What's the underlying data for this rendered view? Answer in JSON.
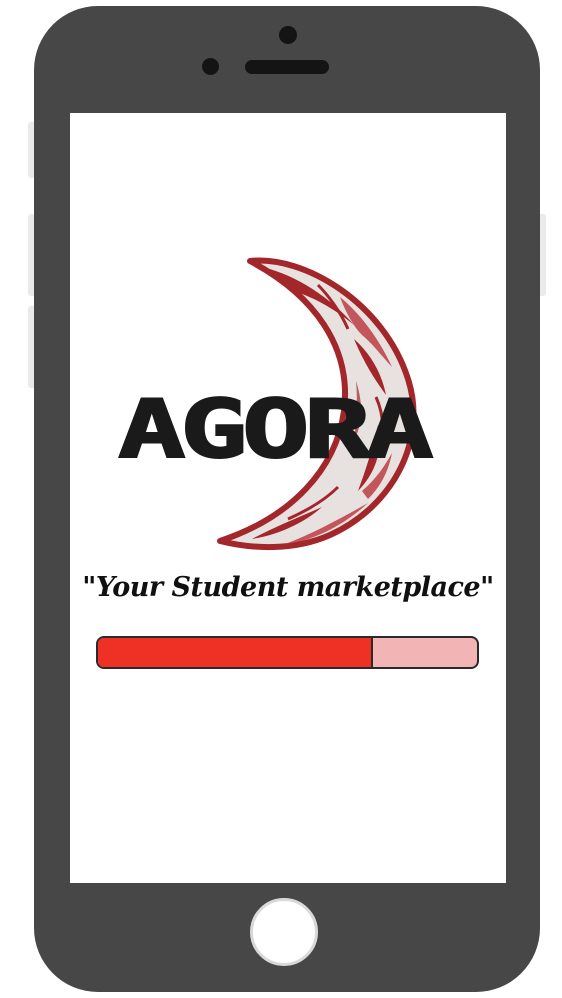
{
  "screen": {
    "logo_text": "AGORA",
    "tagline": "\"Your Student marketplace\"",
    "loading": {
      "progress_percent": 72
    }
  },
  "colors": {
    "phone_body": "#474747",
    "screen_background": "#ffffff",
    "progress_fill": "#ee3124",
    "progress_track": "#f3b4b6",
    "moon_red": "#a3262b",
    "logo_text": "#1a1a1a"
  },
  "icons": {
    "logo": "agora-crescent-moon-logo"
  }
}
